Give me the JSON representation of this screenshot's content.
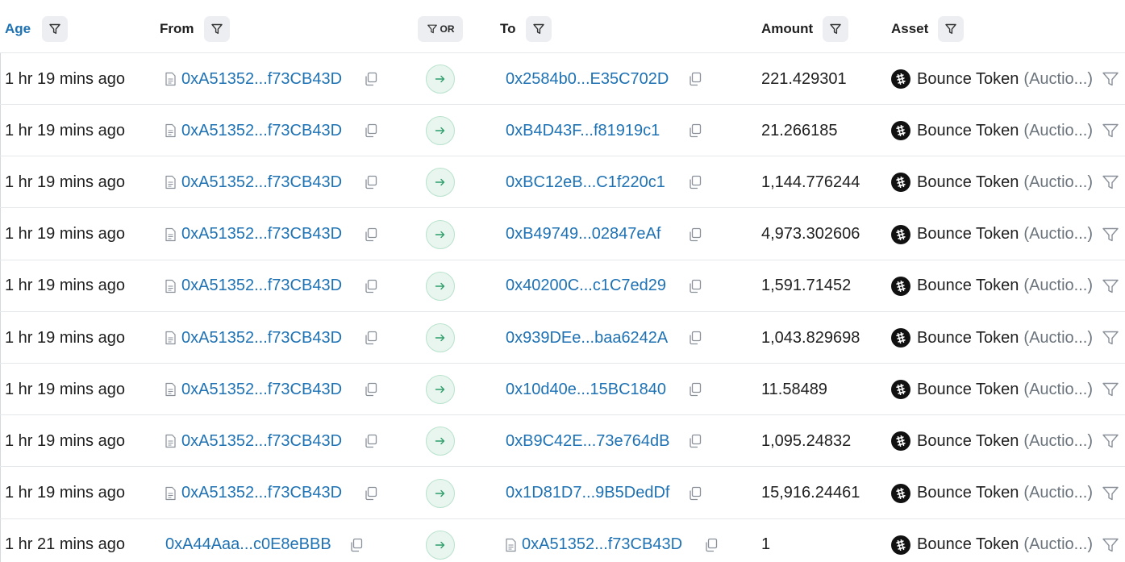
{
  "header": {
    "age_label": "Age",
    "from_label": "From",
    "or_label": "OR",
    "to_label": "To",
    "amount_label": "Amount",
    "asset_label": "Asset"
  },
  "rows": [
    {
      "age": "1 hr 19 mins ago",
      "from": "0xA51352...f73CB43D",
      "from_contract": true,
      "to": "0x2584b0...E35C702D",
      "to_contract": false,
      "amount": "221.429301",
      "token": "Bounce Token",
      "token_sub": "(Auctio...)"
    },
    {
      "age": "1 hr 19 mins ago",
      "from": "0xA51352...f73CB43D",
      "from_contract": true,
      "to": "0xB4D43F...f81919c1",
      "to_contract": false,
      "amount": "21.266185",
      "token": "Bounce Token",
      "token_sub": "(Auctio...)"
    },
    {
      "age": "1 hr 19 mins ago",
      "from": "0xA51352...f73CB43D",
      "from_contract": true,
      "to": "0xBC12eB...C1f220c1",
      "to_contract": false,
      "amount": "1,144.776244",
      "token": "Bounce Token",
      "token_sub": "(Auctio...)"
    },
    {
      "age": "1 hr 19 mins ago",
      "from": "0xA51352...f73CB43D",
      "from_contract": true,
      "to": "0xB49749...02847eAf",
      "to_contract": false,
      "amount": "4,973.302606",
      "token": "Bounce Token",
      "token_sub": "(Auctio...)"
    },
    {
      "age": "1 hr 19 mins ago",
      "from": "0xA51352...f73CB43D",
      "from_contract": true,
      "to": "0x40200C...c1C7ed29",
      "to_contract": false,
      "amount": "1,591.71452",
      "token": "Bounce Token",
      "token_sub": "(Auctio...)"
    },
    {
      "age": "1 hr 19 mins ago",
      "from": "0xA51352...f73CB43D",
      "from_contract": true,
      "to": "0x939DEe...baa6242A",
      "to_contract": false,
      "amount": "1,043.829698",
      "token": "Bounce Token",
      "token_sub": "(Auctio...)"
    },
    {
      "age": "1 hr 19 mins ago",
      "from": "0xA51352...f73CB43D",
      "from_contract": true,
      "to": "0x10d40e...15BC1840",
      "to_contract": false,
      "amount": "11.58489",
      "token": "Bounce Token",
      "token_sub": "(Auctio...)"
    },
    {
      "age": "1 hr 19 mins ago",
      "from": "0xA51352...f73CB43D",
      "from_contract": true,
      "to": "0xB9C42E...73e764dB",
      "to_contract": false,
      "amount": "1,095.24832",
      "token": "Bounce Token",
      "token_sub": "(Auctio...)"
    },
    {
      "age": "1 hr 19 mins ago",
      "from": "0xA51352...f73CB43D",
      "from_contract": true,
      "to": "0x1D81D7...9B5DedDf",
      "to_contract": false,
      "amount": "15,916.24461",
      "token": "Bounce Token",
      "token_sub": "(Auctio...)"
    },
    {
      "age": "1 hr 21 mins ago",
      "from": "0xA44Aaa...c0E8eBBB",
      "from_contract": false,
      "to": "0xA51352...f73CB43D",
      "to_contract": true,
      "amount": "1",
      "token": "Bounce Token",
      "token_sub": "(Auctio...)"
    }
  ],
  "colors": {
    "link": "#1e72b4",
    "arrow_bg": "#e8f6ef",
    "arrow_fg": "#2f9e6b",
    "filter_bg": "#eceef1"
  },
  "icons": {
    "filter": "filter-icon",
    "copy": "copy-icon",
    "contract": "document-icon",
    "direction": "arrow-right-icon",
    "token": "bounce-token-icon"
  }
}
